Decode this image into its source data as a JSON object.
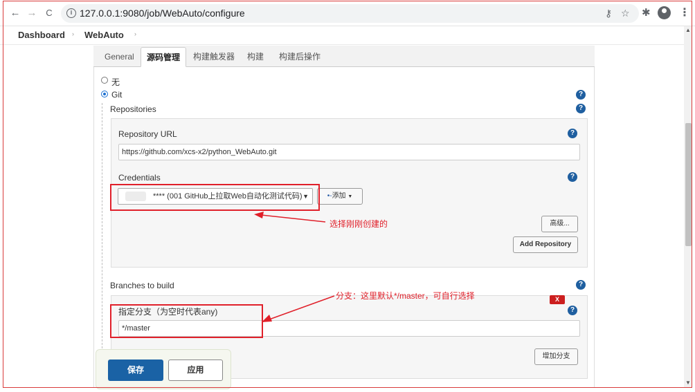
{
  "browser": {
    "url": "127.0.0.1:9080/job/WebAuto/configure",
    "back_icon": "←",
    "forward_icon": "→",
    "reload_icon": "C",
    "key_icon": "⚷",
    "star_icon": "☆",
    "puzzle_icon": "✱",
    "menu_icon": "⋮"
  },
  "breadcrumb": {
    "items": [
      "Dashboard",
      "WebAuto"
    ],
    "separator": "›"
  },
  "tabs": [
    {
      "label": "General",
      "active": false
    },
    {
      "label": "源码管理",
      "active": true
    },
    {
      "label": "构建触发器",
      "active": false
    },
    {
      "label": "构建",
      "active": false
    },
    {
      "label": "构建后操作",
      "active": false
    }
  ],
  "scm": {
    "options": [
      {
        "label": "无",
        "checked": false
      },
      {
        "label": "Git",
        "checked": true
      }
    ],
    "repositories_label": "Repositories",
    "repository_url_label": "Repository URL",
    "repository_url_value": "https://github.com/xcs-x2/python_WebAuto.git",
    "credentials_label": "Credentials",
    "credentials_value": "**** (001 GitHub上拉取Web自动化测试代码)",
    "add_button_label": "添加",
    "advanced_button_label": "高级...",
    "add_repository_label": "Add Repository",
    "branches_label": "Branches to build",
    "branch_specifier_label": "指定分支（为空时代表any)",
    "branch_value": "*/master",
    "delete_branch_label": "X",
    "add_branch_label": "增加分支",
    "help_icon": "?"
  },
  "annotations": {
    "credentials_note": "选择刚刚创建的",
    "branch_note": "分支：这里默认*/master，可自行选择"
  },
  "actions": {
    "save_label": "保存",
    "apply_label": "应用"
  },
  "colors": {
    "primary_button": "#1a62a5",
    "annotation_red": "#e0202a",
    "help_icon": "#1f5fa0"
  }
}
